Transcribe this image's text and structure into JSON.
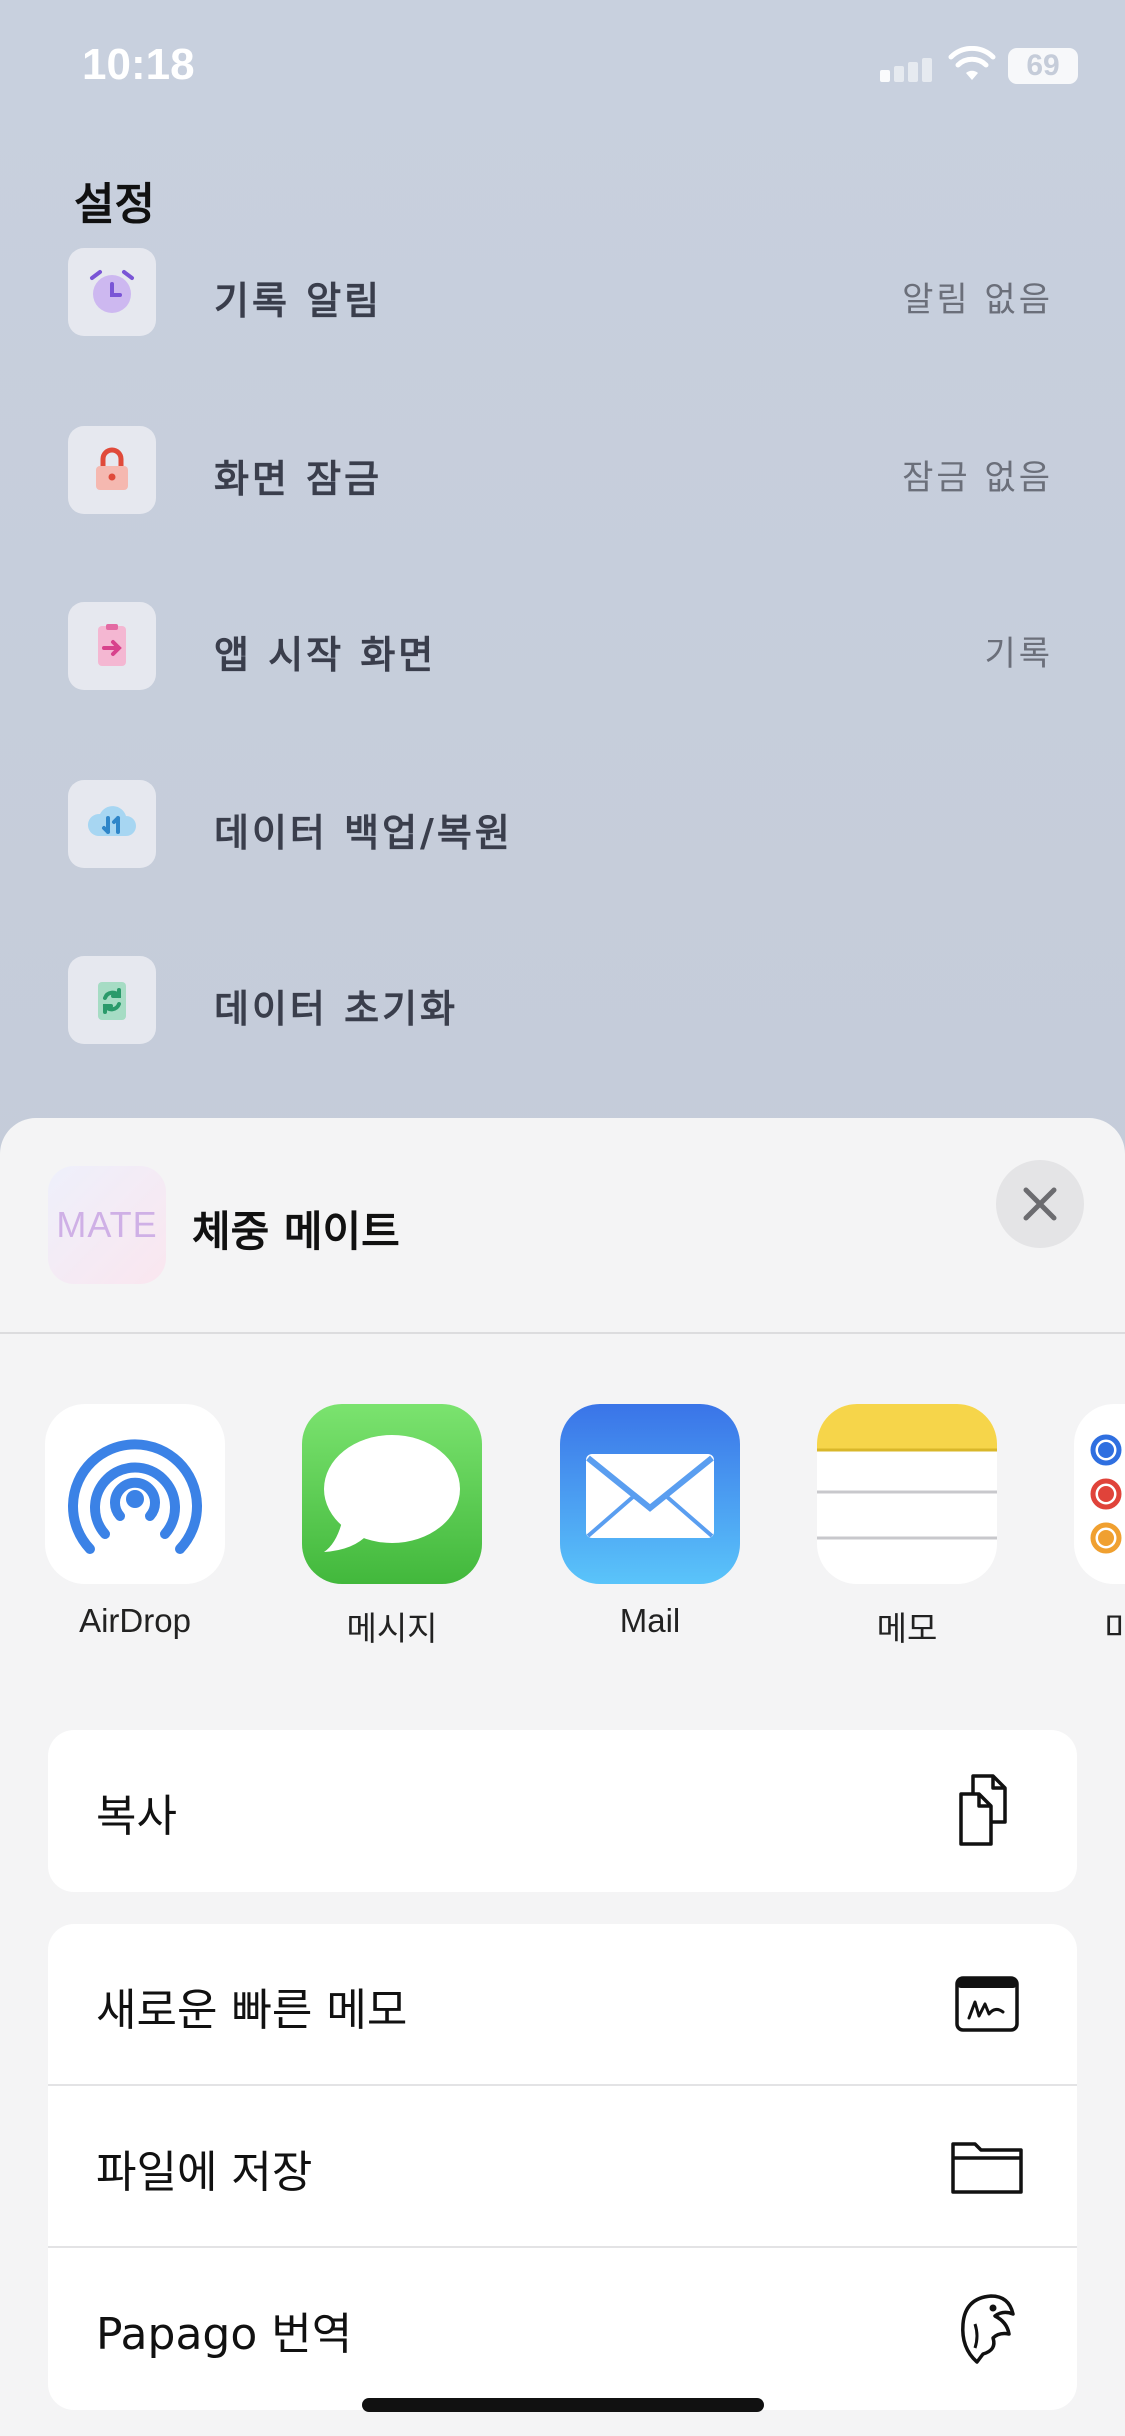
{
  "status": {
    "time": "10:18",
    "battery": "69"
  },
  "settings": {
    "title": "설정",
    "items": [
      {
        "label": "기록 알림",
        "value": "알림 없음",
        "icon": "alarm-clock-icon"
      },
      {
        "label": "화면 잠금",
        "value": "잠금 없음",
        "icon": "lock-icon"
      },
      {
        "label": "앱 시작 화면",
        "value": "기록",
        "icon": "start-screen-icon"
      },
      {
        "label": "데이터 백업/복원",
        "value": "",
        "icon": "cloud-sync-icon"
      },
      {
        "label": "데이터 초기화",
        "value": "",
        "icon": "reset-icon"
      }
    ]
  },
  "share_sheet": {
    "app_thumb_text": "MATE",
    "app_name": "체중 메이트",
    "apps": [
      {
        "label": "AirDrop",
        "icon": "airdrop-icon"
      },
      {
        "label": "메시지",
        "icon": "messages-icon"
      },
      {
        "label": "Mail",
        "icon": "mail-icon"
      },
      {
        "label": "메모",
        "icon": "notes-icon"
      },
      {
        "label": "미",
        "icon": "reminders-icon"
      }
    ],
    "actions_group1": [
      {
        "label": "복사",
        "icon": "copy-icon"
      }
    ],
    "actions_group2": [
      {
        "label": "새로운 빠른 메모",
        "icon": "quick-note-icon"
      },
      {
        "label": "파일에 저장",
        "icon": "folder-icon"
      },
      {
        "label": "Papago 번역",
        "icon": "papago-icon"
      }
    ]
  },
  "colors": {
    "messages_green": "#5fce5a",
    "mail_blue": "#3c8cf5",
    "notes_yellow": "#f6d54a",
    "airdrop_blue": "#3b82e6"
  }
}
